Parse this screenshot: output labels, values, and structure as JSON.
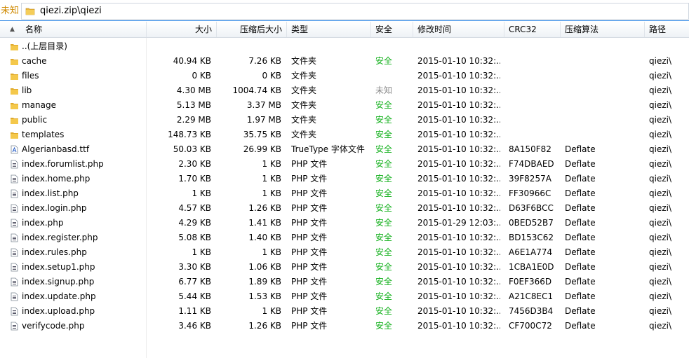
{
  "toolbar": {
    "unknown_label": "未知"
  },
  "address": {
    "path": "qiezi.zip\\qiezi"
  },
  "header": {
    "name": "名称",
    "size": "大小",
    "compressed": "压缩后大小",
    "type": "类型",
    "safety": "安全",
    "modified": "修改时间",
    "crc": "CRC32",
    "method": "压缩算法",
    "path": "路径"
  },
  "colors": {
    "safe": "#12b01b",
    "unknown": "#8a8a8a",
    "accent": "#3b8ee6"
  },
  "rows": [
    {
      "icon": "folder-icon",
      "name": "..(上层目录)",
      "size": "",
      "csize": "",
      "type": "",
      "safety": "",
      "time": "",
      "crc": "",
      "method": "",
      "path": ""
    },
    {
      "icon": "folder-icon",
      "name": "cache",
      "size": "40.94 KB",
      "csize": "7.26 KB",
      "type": "文件夹",
      "safety": "安全",
      "time": "2015-01-10 10:32:...",
      "crc": "",
      "method": "",
      "path": "qiezi\\"
    },
    {
      "icon": "folder-icon",
      "name": "files",
      "size": "0 KB",
      "csize": "0 KB",
      "type": "文件夹",
      "safety": "",
      "time": "2015-01-10 10:32:...",
      "crc": "",
      "method": "",
      "path": "qiezi\\"
    },
    {
      "icon": "folder-icon",
      "name": "lib",
      "size": "4.30 MB",
      "csize": "1004.74 KB",
      "type": "文件夹",
      "safety": "未知",
      "time": "2015-01-10 10:32:...",
      "crc": "",
      "method": "",
      "path": "qiezi\\"
    },
    {
      "icon": "folder-icon",
      "name": "manage",
      "size": "5.13 MB",
      "csize": "3.37 MB",
      "type": "文件夹",
      "safety": "安全",
      "time": "2015-01-10 10:32:...",
      "crc": "",
      "method": "",
      "path": "qiezi\\"
    },
    {
      "icon": "folder-icon",
      "name": "public",
      "size": "2.29 MB",
      "csize": "1.97 MB",
      "type": "文件夹",
      "safety": "安全",
      "time": "2015-01-10 10:32:...",
      "crc": "",
      "method": "",
      "path": "qiezi\\"
    },
    {
      "icon": "folder-icon",
      "name": "templates",
      "size": "148.73 KB",
      "csize": "35.75 KB",
      "type": "文件夹",
      "safety": "安全",
      "time": "2015-01-10 10:32:...",
      "crc": "",
      "method": "",
      "path": "qiezi\\"
    },
    {
      "icon": "font-file-icon",
      "name": "Algerianbasd.ttf",
      "size": "50.03 KB",
      "csize": "26.99 KB",
      "type": "TrueType 字体文件",
      "safety": "安全",
      "time": "2015-01-10 10:32:...",
      "crc": "8A150F82",
      "method": "Deflate",
      "path": "qiezi\\"
    },
    {
      "icon": "php-file-icon",
      "name": "index.forumlist.php",
      "size": "2.30 KB",
      "csize": "1 KB",
      "type": "PHP 文件",
      "safety": "安全",
      "time": "2015-01-10 10:32:...",
      "crc": "F74DBAED",
      "method": "Deflate",
      "path": "qiezi\\"
    },
    {
      "icon": "php-file-icon",
      "name": "index.home.php",
      "size": "1.70 KB",
      "csize": "1 KB",
      "type": "PHP 文件",
      "safety": "安全",
      "time": "2015-01-10 10:32:...",
      "crc": "39F8257A",
      "method": "Deflate",
      "path": "qiezi\\"
    },
    {
      "icon": "php-file-icon",
      "name": "index.list.php",
      "size": "1 KB",
      "csize": "1 KB",
      "type": "PHP 文件",
      "safety": "安全",
      "time": "2015-01-10 10:32:...",
      "crc": "FF30966C",
      "method": "Deflate",
      "path": "qiezi\\"
    },
    {
      "icon": "php-file-icon",
      "name": "index.login.php",
      "size": "4.57 KB",
      "csize": "1.26 KB",
      "type": "PHP 文件",
      "safety": "安全",
      "time": "2015-01-10 10:32:...",
      "crc": "D63F6BCC",
      "method": "Deflate",
      "path": "qiezi\\"
    },
    {
      "icon": "php-file-icon",
      "name": "index.php",
      "size": "4.29 KB",
      "csize": "1.41 KB",
      "type": "PHP 文件",
      "safety": "安全",
      "time": "2015-01-29 12:03:...",
      "crc": "0BED52B7",
      "method": "Deflate",
      "path": "qiezi\\"
    },
    {
      "icon": "php-file-icon",
      "name": "index.register.php",
      "size": "5.08 KB",
      "csize": "1.40 KB",
      "type": "PHP 文件",
      "safety": "安全",
      "time": "2015-01-10 10:32:...",
      "crc": "BD153C62",
      "method": "Deflate",
      "path": "qiezi\\"
    },
    {
      "icon": "php-file-icon",
      "name": "index.rules.php",
      "size": "1 KB",
      "csize": "1 KB",
      "type": "PHP 文件",
      "safety": "安全",
      "time": "2015-01-10 10:32:...",
      "crc": "A6E1A774",
      "method": "Deflate",
      "path": "qiezi\\"
    },
    {
      "icon": "php-file-icon",
      "name": "index.setup1.php",
      "size": "3.30 KB",
      "csize": "1.06 KB",
      "type": "PHP 文件",
      "safety": "安全",
      "time": "2015-01-10 10:32:...",
      "crc": "1CBA1E0D",
      "method": "Deflate",
      "path": "qiezi\\"
    },
    {
      "icon": "php-file-icon",
      "name": "index.signup.php",
      "size": "6.77 KB",
      "csize": "1.89 KB",
      "type": "PHP 文件",
      "safety": "安全",
      "time": "2015-01-10 10:32:...",
      "crc": "F0EF366D",
      "method": "Deflate",
      "path": "qiezi\\"
    },
    {
      "icon": "php-file-icon",
      "name": "index.update.php",
      "size": "5.44 KB",
      "csize": "1.53 KB",
      "type": "PHP 文件",
      "safety": "安全",
      "time": "2015-01-10 10:32:...",
      "crc": "A21C8EC1",
      "method": "Deflate",
      "path": "qiezi\\"
    },
    {
      "icon": "php-file-icon",
      "name": "index.upload.php",
      "size": "1.11 KB",
      "csize": "1 KB",
      "type": "PHP 文件",
      "safety": "安全",
      "time": "2015-01-10 10:32:...",
      "crc": "7456D3B4",
      "method": "Deflate",
      "path": "qiezi\\"
    },
    {
      "icon": "php-file-icon",
      "name": "verifycode.php",
      "size": "3.46 KB",
      "csize": "1.26 KB",
      "type": "PHP 文件",
      "safety": "安全",
      "time": "2015-01-10 10:32:...",
      "crc": "CF700C72",
      "method": "Deflate",
      "path": "qiezi\\"
    }
  ]
}
